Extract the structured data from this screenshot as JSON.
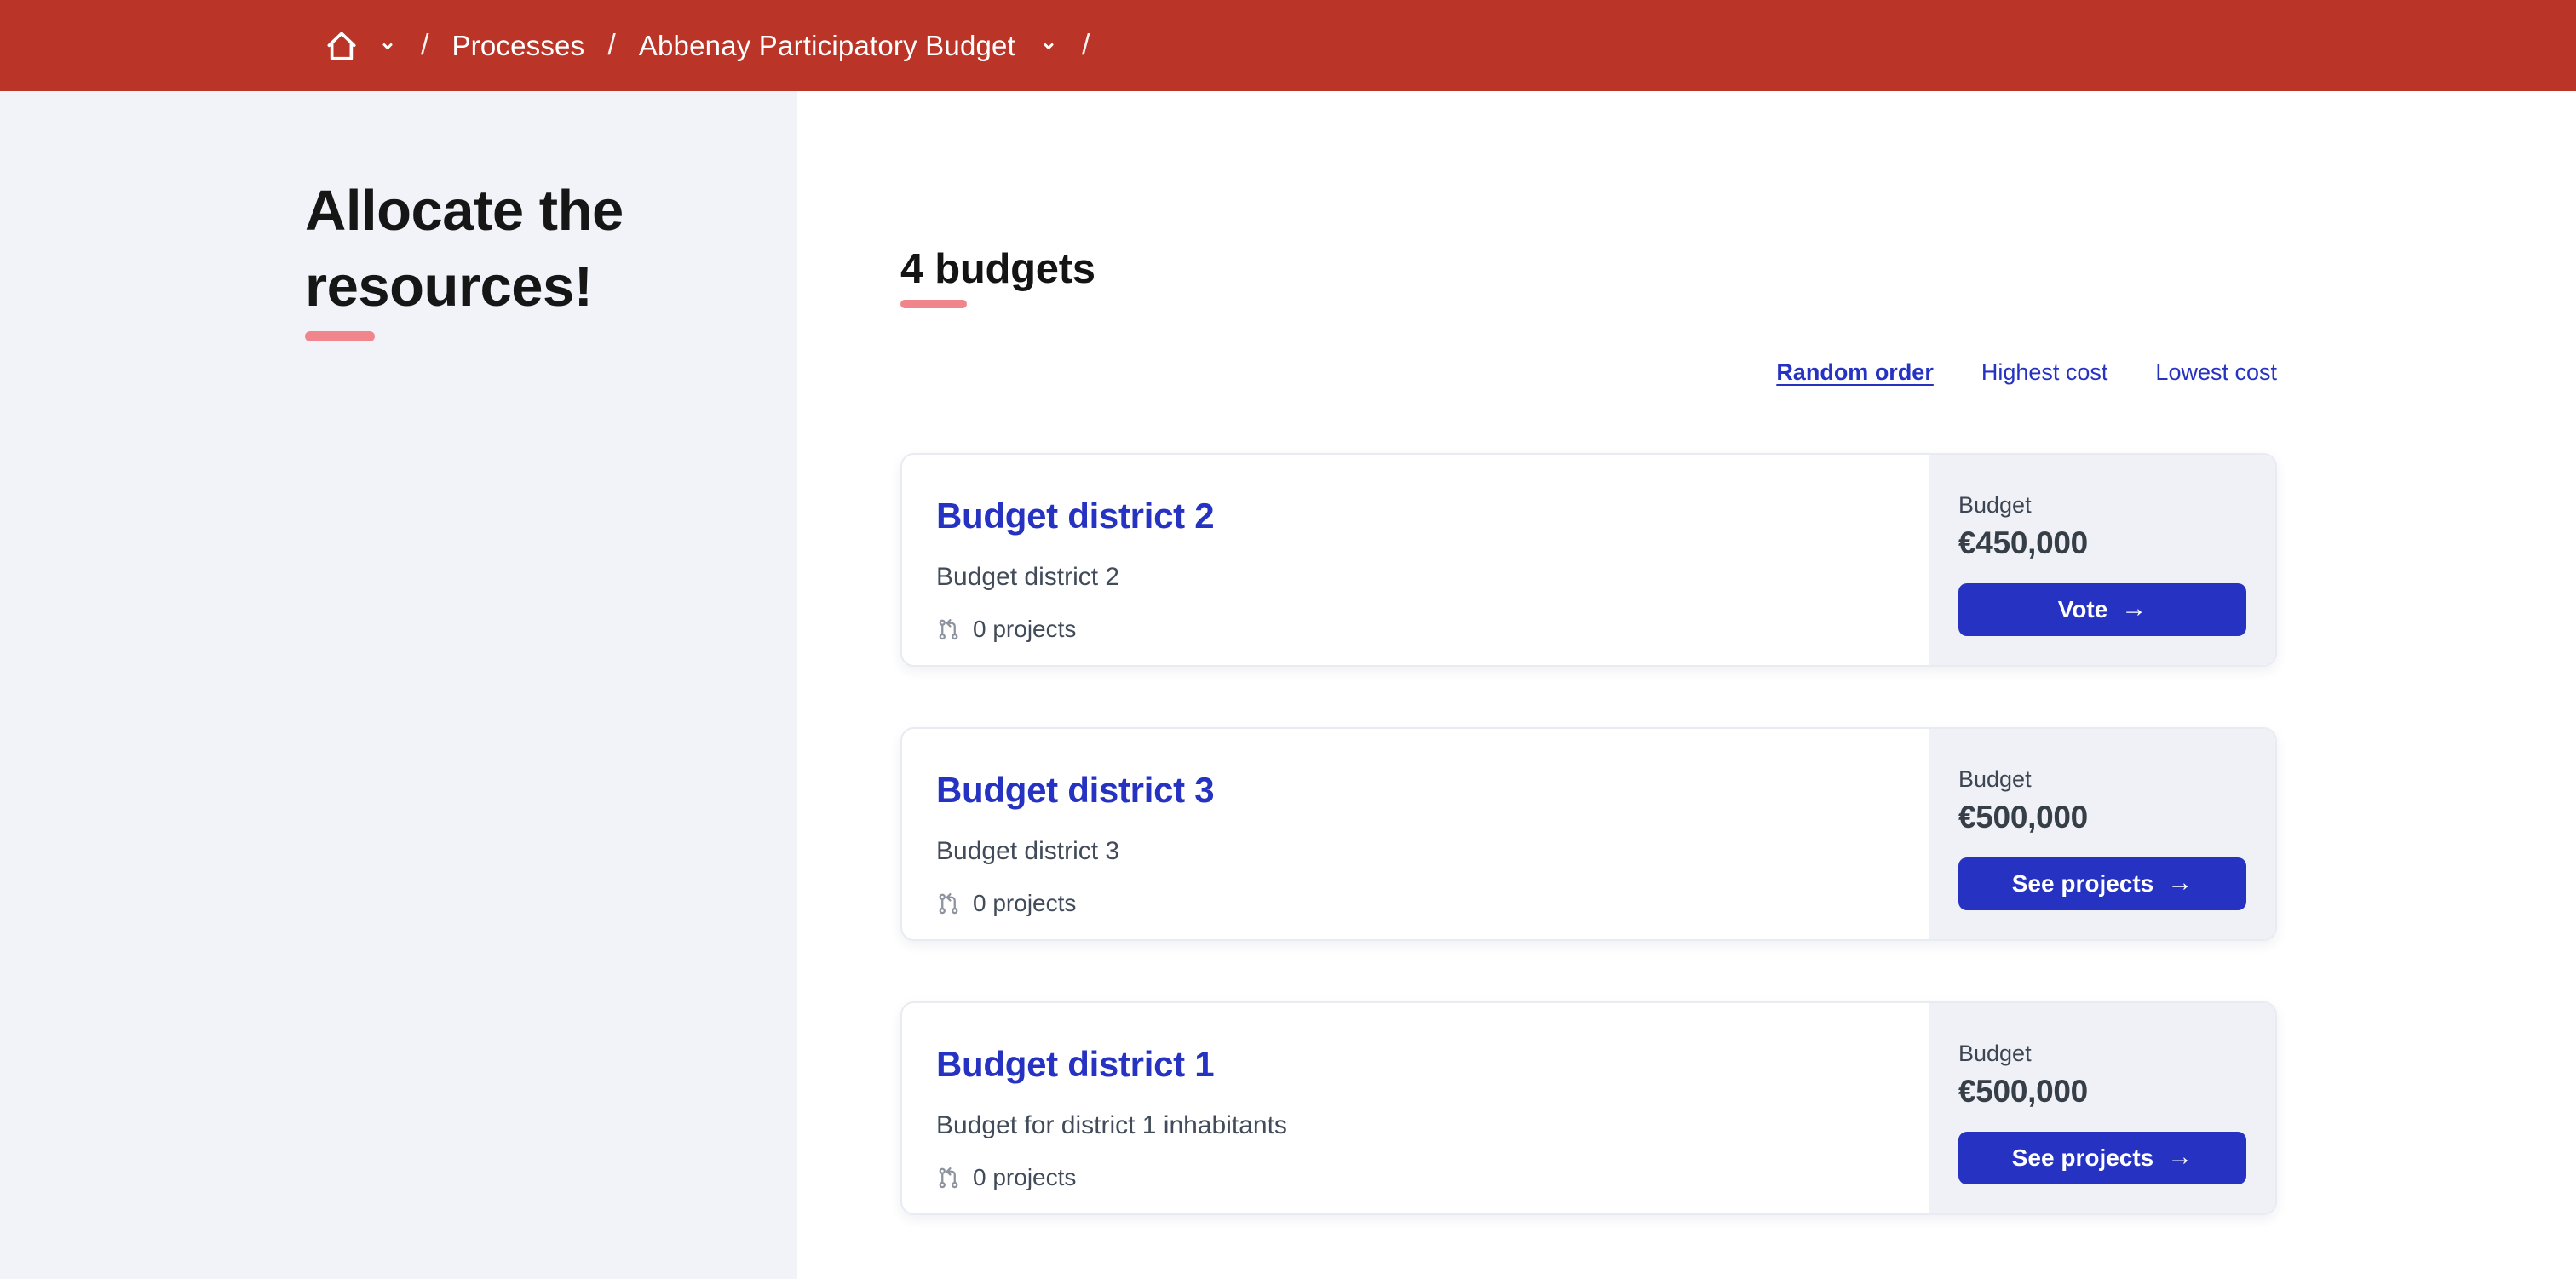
{
  "colors": {
    "topbar_red": "#ba3527",
    "primary_blue": "#2632c1",
    "accent_salmon": "#f0868b",
    "sidebar_gray": "#f2f3f8",
    "aside_gray": "#f0f1f6"
  },
  "icons": {
    "home": "home-icon",
    "chevron_down": "chevron-down-icon",
    "projects": "git-pull-request-icon",
    "arrow_right": "→"
  },
  "breadcrumb": {
    "separator": "/",
    "processes_label": "Processes",
    "process_label": "Abbenay Participatory Budget"
  },
  "sidebar": {
    "title": "Allocate the resources!"
  },
  "main": {
    "heading": "4 budgets",
    "sort": [
      {
        "label": "Random order",
        "active": true
      },
      {
        "label": "Highest cost",
        "active": false
      },
      {
        "label": "Lowest cost",
        "active": false
      }
    ],
    "cards": [
      {
        "title": "Budget district 2",
        "description": "Budget district 2",
        "projects_count": "0 projects",
        "budget_label": "Budget",
        "amount": "€450,000",
        "button_label": "Vote"
      },
      {
        "title": "Budget district 3",
        "description": "Budget district 3",
        "projects_count": "0 projects",
        "budget_label": "Budget",
        "amount": "€500,000",
        "button_label": "See projects"
      },
      {
        "title": "Budget district 1",
        "description": "Budget for district 1 inhabitants",
        "projects_count": "0 projects",
        "budget_label": "Budget",
        "amount": "€500,000",
        "button_label": "See projects"
      }
    ]
  }
}
